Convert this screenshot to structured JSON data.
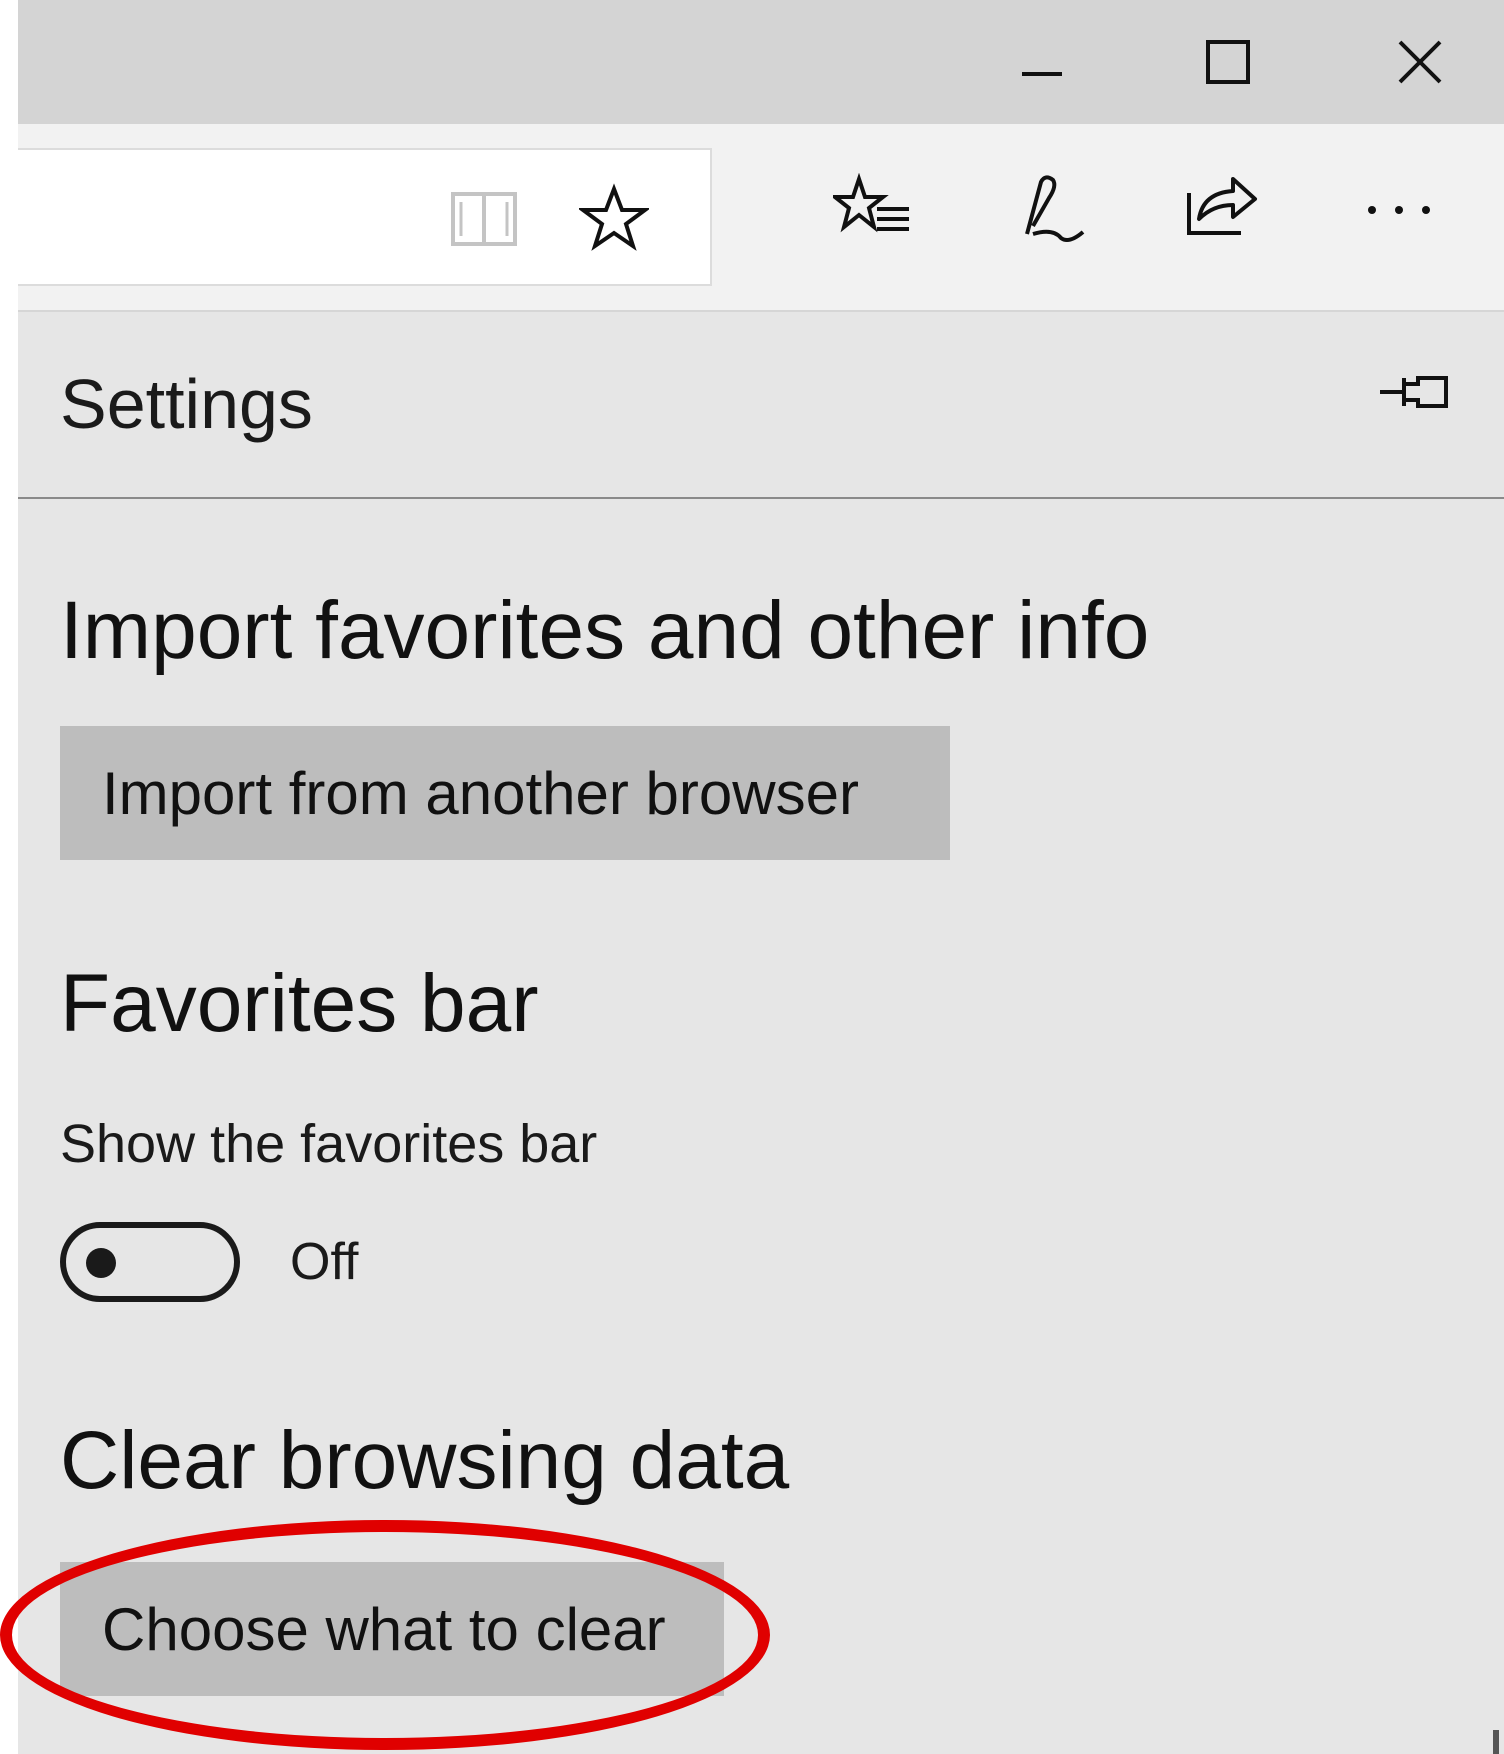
{
  "window": {
    "controls": {
      "minimize": "minimize-icon",
      "maximize": "maximize-icon",
      "close": "close-icon"
    }
  },
  "toolbar": {
    "address_icons": [
      "reading-view-icon",
      "favorite-star-icon"
    ],
    "icons": [
      "favorites-hub-icon",
      "web-note-icon",
      "share-icon",
      "more-icon"
    ]
  },
  "settings": {
    "title": "Settings",
    "pin_icon": "pin-icon",
    "import_section": {
      "heading": "Import favorites and other info",
      "button_label": "Import from another browser"
    },
    "favorites_bar_section": {
      "heading": "Favorites bar",
      "toggle_label": "Show the favorites bar",
      "toggle_state": "Off"
    },
    "clear_section": {
      "heading": "Clear browsing data",
      "button_label": "Choose what to clear"
    }
  },
  "colors": {
    "titlebar": "#d4d4d4",
    "toolbar": "#f2f2f2",
    "pane": "#e6e6e6",
    "button": "#bdbdbd",
    "highlight": "#e00000"
  }
}
